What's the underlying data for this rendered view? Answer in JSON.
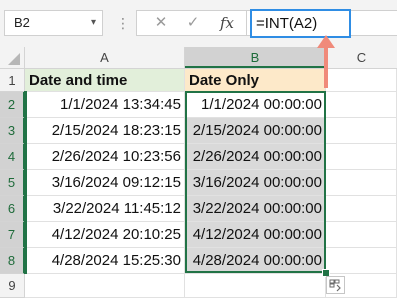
{
  "name_box": {
    "value": "B2"
  },
  "formula_bar": {
    "cancel_glyph": "✕",
    "enter_glyph": "✓",
    "fx_label": "fx",
    "formula": "=INT(A2)"
  },
  "columns": [
    "A",
    "B",
    "C"
  ],
  "rows": [
    "1",
    "2",
    "3",
    "4",
    "5",
    "6",
    "7",
    "8",
    "9"
  ],
  "headers": {
    "a": "Date and time",
    "b": "Date Only"
  },
  "data_rows": [
    {
      "a": "1/1/2024 13:34:45",
      "b": "1/1/2024 00:00:00"
    },
    {
      "a": "2/15/2024 18:23:15",
      "b": "2/15/2024 00:00:00"
    },
    {
      "a": "2/26/2024 10:23:56",
      "b": "2/26/2024 00:00:00"
    },
    {
      "a": "3/16/2024 09:12:15",
      "b": "3/16/2024 00:00:00"
    },
    {
      "a": "3/22/2024 11:45:12",
      "b": "3/22/2024 00:00:00"
    },
    {
      "a": "4/12/2024 20:10:25",
      "b": "4/12/2024 00:00:00"
    },
    {
      "a": "4/28/2024 15:25:30",
      "b": "4/28/2024 00:00:00"
    }
  ],
  "colors": {
    "selection": "#217346",
    "header_a_fill": "#e2efda",
    "header_b_fill": "#fde9c9",
    "annotation_arrow": "#f08a7a",
    "formula_highlight": "#2f8de4"
  },
  "icons": {
    "name_box_dropdown": "chevron-down-icon",
    "quick_analysis": "quick-analysis-icon",
    "select_all": "select-all-triangle-icon"
  }
}
